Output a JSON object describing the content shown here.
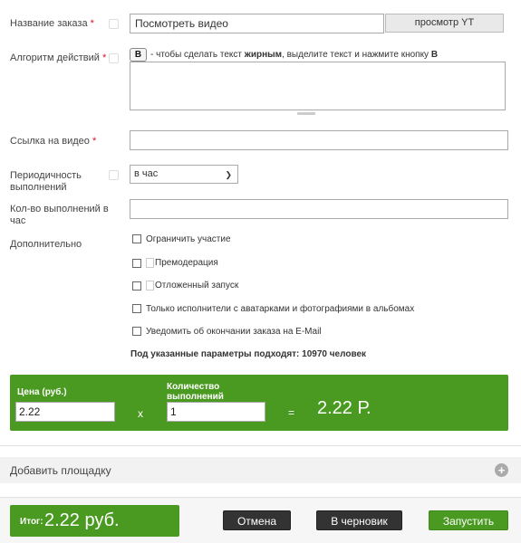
{
  "form": {
    "order_name": {
      "label": "Название заказа",
      "required_mark": "*",
      "value": "Посмотреть видео",
      "preview_button": "просмотр YT"
    },
    "algorithm": {
      "label": "Алгоритм действий",
      "required_mark": "*",
      "bold_button": "B",
      "hint_before": "- чтобы сделать текст ",
      "hint_bold": "жирным",
      "hint_after": ", выделите текст и нажмите кнопку ",
      "hint_key": "B",
      "value": ""
    },
    "video_link": {
      "label": "Ссылка на видео",
      "required_mark": "*",
      "value": ""
    },
    "periodicity": {
      "label_line1": "Периодичность",
      "label_line2": "выполнений",
      "selected": "в час"
    },
    "executions_count": {
      "label_line1": "Кол-во выполнений в",
      "label_line2": "час",
      "value": ""
    },
    "additional": {
      "label": "Дополнительно",
      "options": [
        {
          "label": "Ограничить участие",
          "checked": false
        },
        {
          "label": "Премодерация",
          "checked": false
        },
        {
          "label": "Отложенный запуск",
          "checked": false
        },
        {
          "label": "Только исполнители с аватарками и фотографиями в альбомах",
          "checked": false
        },
        {
          "label": "Уведомить об окончании заказа на E-Mail",
          "checked": false
        }
      ],
      "match_text": "Под указанные параметры подходят: 10970 человек"
    }
  },
  "pricing": {
    "price_label": "Цена (руб.)",
    "price_value": "2.22",
    "multiply": "x",
    "qty_label_line1": "Количество",
    "qty_label_line2": "выполнений",
    "qty_value": "1",
    "equals": "=",
    "total": "2.22 Р."
  },
  "add_platform": {
    "label": "Добавить площадку",
    "icon": "plus-circle-icon"
  },
  "footer": {
    "total_caption": "Итог:",
    "total_value": "2.22 руб.",
    "cancel": "Отмена",
    "draft": "В черновик",
    "launch": "Запустить"
  },
  "colors": {
    "accent": "#4a9a22",
    "dark_button": "#333333",
    "required": "#dd1122"
  }
}
